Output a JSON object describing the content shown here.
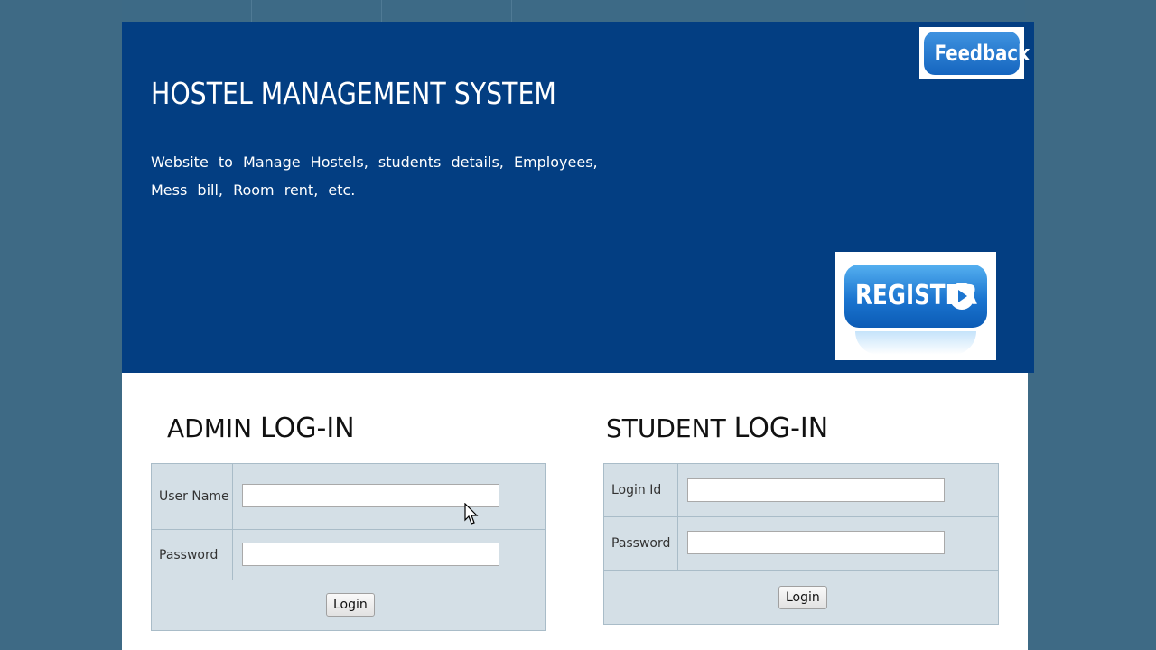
{
  "header": {
    "title": "HOSTEL MANAGEMENT SYSTEM",
    "description": "Website to Manage Hostels, students details, Employees, Mess bill, Room rent, etc.",
    "feedback_label": "Feedback",
    "register_label": "REGISTER"
  },
  "admin": {
    "title_word1": "ADMIN",
    "title_word2": "LOG-IN",
    "username_label": "User Name",
    "username_value": "",
    "password_label": "Password",
    "password_value": "",
    "login_label": "Login"
  },
  "student": {
    "title_word1": "STUDENT",
    "title_word2": "LOG-IN",
    "loginid_label": "Login Id",
    "loginid_value": "",
    "password_label": "Password",
    "password_value": "",
    "login_label": "Login"
  },
  "colors": {
    "background": "#3e6a85",
    "banner": "#033e82",
    "form_panel": "#d4dfe6",
    "button_blue": "#1b75d0"
  },
  "icons": {
    "register_arrow": "play-circle-icon",
    "cursor": "mouse-pointer-icon"
  }
}
